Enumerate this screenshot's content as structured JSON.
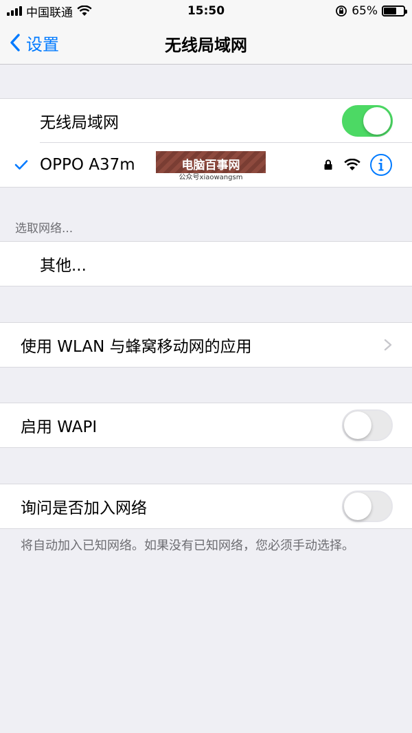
{
  "status_bar": {
    "carrier": "中国联通",
    "time": "15:50",
    "battery_percent": "65%",
    "battery_level": 0.65
  },
  "nav": {
    "back_label": "设置",
    "title": "无线局域网"
  },
  "wifi_section": {
    "toggle_label": "无线局域网",
    "toggle_on": true,
    "connected_network": "OPPO A37m"
  },
  "choose_network": {
    "header": "选取网络...",
    "other_label": "其他..."
  },
  "wlan_apps": {
    "label": "使用 WLAN 与蜂窝移动网的应用"
  },
  "wapi": {
    "label": "启用 WAPI",
    "toggle_on": false
  },
  "ask_join": {
    "label": "询问是否加入网络",
    "toggle_on": false,
    "footer": "将自动加入已知网络。如果没有已知网络，您必须手动选择。"
  },
  "watermark": {
    "title": "电脑百事网",
    "subtitle": "公众号xiaowangsm"
  },
  "colors": {
    "accent": "#007aff",
    "toggle_on": "#4cd964",
    "background": "#efeff4"
  }
}
